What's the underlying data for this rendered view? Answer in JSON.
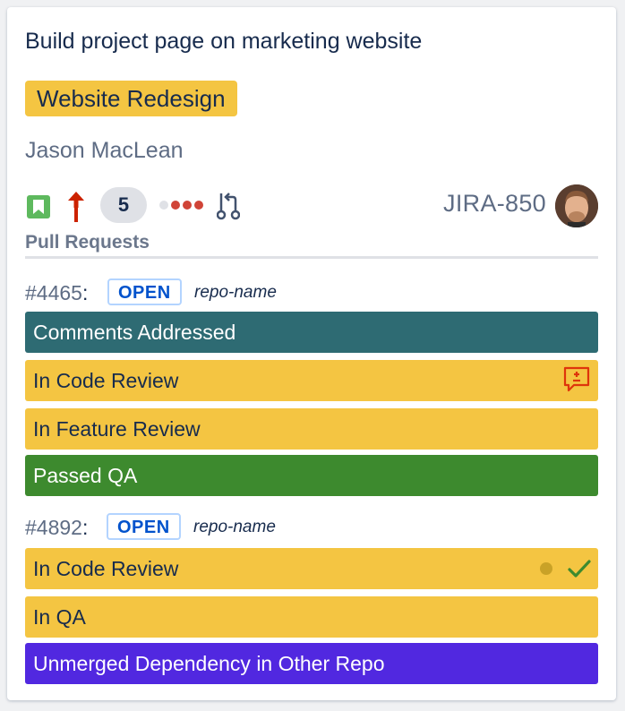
{
  "card": {
    "title": "Build project page on marketing website",
    "epic": "Website Redesign",
    "assignee": "Jason MacLean",
    "estimate": "5",
    "issue_key": "JIRA-850",
    "colors": {
      "epic": "#f4c542",
      "story": "#5eb95e",
      "priority": "#cc2200"
    }
  },
  "pull_requests": {
    "heading": "Pull Requests",
    "items": [
      {
        "number": "#4465",
        "colon": ":",
        "state": "OPEN",
        "repo": "repo-name",
        "statuses": [
          {
            "label": "Comments Addressed",
            "color": "#2e6b73"
          },
          {
            "label": "In Code Review",
            "color": "#f4c542"
          },
          {
            "label": "In Feature Review",
            "color": "#f4c542"
          },
          {
            "label": "Passed QA",
            "color": "#3d8a2e"
          }
        ]
      },
      {
        "number": "#4892",
        "colon": ":",
        "state": "OPEN",
        "repo": "repo-name",
        "statuses": [
          {
            "label": "In Code Review",
            "color": "#f4c542"
          },
          {
            "label": "In QA",
            "color": "#f4c542"
          },
          {
            "label": "Unmerged Dependency in Other Repo",
            "color": "#5128e0"
          }
        ]
      }
    ]
  },
  "icons": {
    "story": "bookmark-icon",
    "priority": "arrow-up-icon",
    "progress": "dots-icon",
    "pull_request": "pull-request-icon",
    "review_comment": "comment-plus-minus-icon",
    "pending": "pending-dot-icon",
    "approved": "checkmark-icon"
  }
}
